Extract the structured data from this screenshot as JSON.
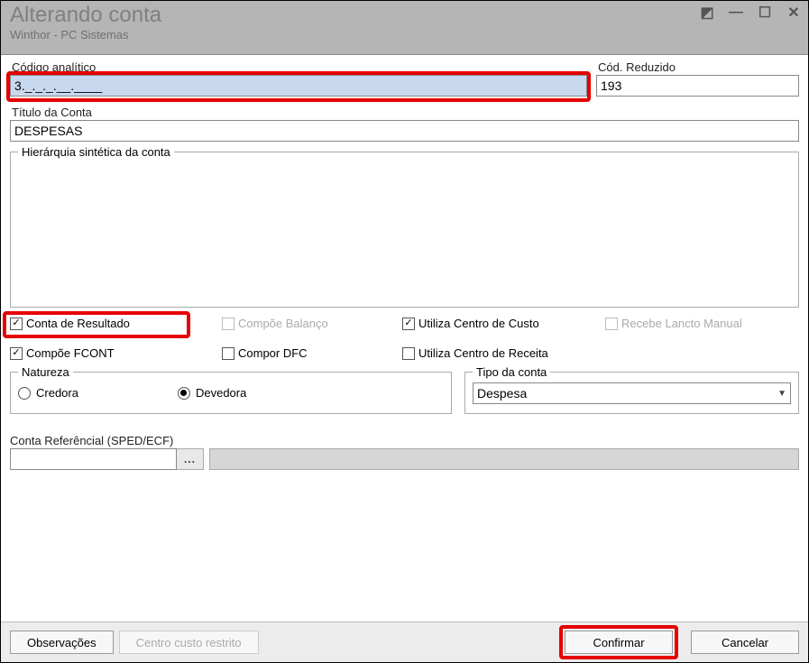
{
  "window": {
    "title": "Alterando conta",
    "subtitle": "Winthor - PC Sistemas"
  },
  "fields": {
    "codigo_analitico_label": "Código analítico",
    "codigo_analitico_value": "3._._._.__.____",
    "cod_reduzido_label": "Cód. Reduzido",
    "cod_reduzido_value": "193",
    "titulo_label": "Título da Conta",
    "titulo_value": "DESPESAS",
    "hierarquia_legend": "Hierárquia sintética da conta"
  },
  "checks": {
    "conta_resultado": "Conta de Resultado",
    "compoe_balanco": "Compõe Balanço",
    "utiliza_centro_custo": "Utiliza Centro de Custo",
    "recebe_lancto_manual": "Recebe Lancto Manual",
    "compoe_fcont": "Compõe FCONT",
    "compor_dfc": "Compor DFC",
    "utiliza_centro_receita": "Utiliza Centro de Receita"
  },
  "natureza": {
    "legend": "Natureza",
    "credora": "Credora",
    "devedora": "Devedora"
  },
  "tipo": {
    "legend": "Tipo da conta",
    "value": "Despesa"
  },
  "referencial": {
    "label": "Conta Referêncial (SPED/ECF)",
    "btn": "..."
  },
  "buttons": {
    "observacoes": "Observações",
    "centro_custo": "Centro custo restrito",
    "confirmar": "Confirmar",
    "cancelar": "Cancelar"
  }
}
